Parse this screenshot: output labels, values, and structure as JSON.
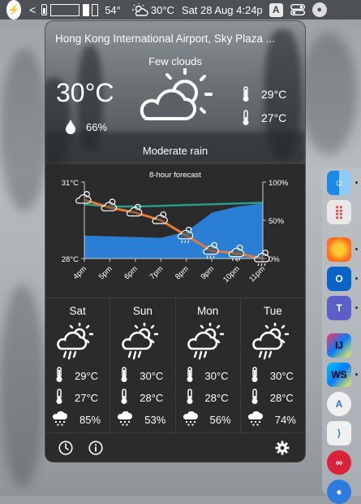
{
  "menubar": {
    "battery_percent": "54°",
    "weather": "30°C",
    "datetime": "Sat 28 Aug 4:24p",
    "input_source": "A"
  },
  "widget": {
    "location": "Hong Kong International Airport, Sky Plaza ...",
    "condition": "Few clouds",
    "temperature": "30°C",
    "humidity": "66%",
    "high": "29°C",
    "low": "27°C",
    "description": "Moderate rain"
  },
  "chart_data": {
    "type": "line",
    "title": "8-hour forecast",
    "categories": [
      "4pm",
      "5pm",
      "6pm",
      "7pm",
      "8pm",
      "9pm",
      "10pm",
      "11pm"
    ],
    "series": [
      {
        "name": "temperature",
        "axis": "left",
        "color": "#e07b39",
        "values": [
          30.3,
          30.0,
          29.8,
          29.5,
          28.9,
          28.3,
          28.2,
          28.0
        ]
      },
      {
        "name": "humidity",
        "axis": "right",
        "color": "#2a7fd4",
        "values": [
          30,
          29,
          28,
          27,
          35,
          60,
          68,
          72
        ]
      },
      {
        "name": "precipitation",
        "axis": "right",
        "color": "#2aa08a",
        "values": [
          71,
          68,
          68,
          69,
          70,
          71,
          72,
          73
        ]
      }
    ],
    "ylim_left": [
      28,
      31
    ],
    "ylim_right": [
      0,
      100
    ],
    "left_ticks": [
      "31°C",
      "28°C"
    ],
    "right_ticks": [
      "100%",
      "50%",
      "0%"
    ]
  },
  "days": [
    {
      "name": "Sat",
      "high": "29°C",
      "low": "27°C",
      "rain": "85%"
    },
    {
      "name": "Sun",
      "high": "30°C",
      "low": "28°C",
      "rain": "53%"
    },
    {
      "name": "Mon",
      "high": "30°C",
      "low": "28°C",
      "rain": "56%"
    },
    {
      "name": "Tue",
      "high": "30°C",
      "low": "28°C",
      "rain": "74%"
    }
  ],
  "icons": {
    "hero": "partly-cloudy-icon",
    "day": "sun-cloud-rain-icon",
    "footer": [
      "clock-icon",
      "info-icon",
      "gear-icon"
    ]
  },
  "dock": [
    "Finder",
    "Launchpad",
    "Firefox",
    "Outlook",
    "Teams",
    "IntelliJ IDEA",
    "WebStorm",
    "Android Studio",
    "VS Code",
    "Mendeley",
    "Maps"
  ]
}
